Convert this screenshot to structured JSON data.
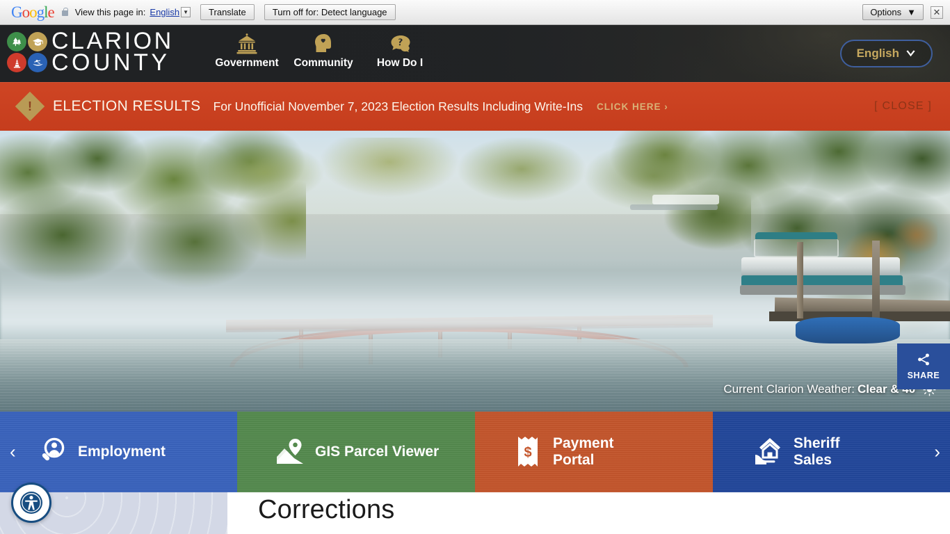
{
  "translate_bar": {
    "brand": "Google",
    "lock_icon": "lock-icon",
    "label": "View this page in:",
    "language_link": "English",
    "dropdown_arrow": "▼",
    "translate_button": "Translate",
    "turnoff_button": "Turn off for: Detect language",
    "options_button": "Options",
    "options_arrow": "▼",
    "close_x": "✕"
  },
  "header": {
    "logo_line1": "CLARION",
    "logo_line2": "COUNTY",
    "logo_icons": [
      "trees-icon",
      "graduation-cap-icon",
      "oil-derrick-icon",
      "canoe-icon"
    ],
    "nav": [
      {
        "label": "Government",
        "icon": "courthouse-icon"
      },
      {
        "label": "Community",
        "icon": "head-heart-icon"
      },
      {
        "label": "How Do I",
        "icon": "question-bubble-icon"
      }
    ],
    "language_selector": {
      "label": "English",
      "chevron": "❯"
    }
  },
  "alert": {
    "icon": "alert-diamond-icon",
    "exclamation": "!",
    "title": "ELECTION RESULTS",
    "message": "For Unofficial November 7, 2023 Election Results Including Write-Ins",
    "cta": "CLICK HERE  ›",
    "close": "[ CLOSE ]"
  },
  "hero": {
    "weather_prefix": "Current Clarion Weather:",
    "weather_value": "Clear & 40°",
    "weather_icon": "sun-icon",
    "share": {
      "label": "SHARE",
      "icon": "share-nodes-icon"
    }
  },
  "quick_links": {
    "prev_arrow": "‹",
    "next_arrow": "›",
    "items": [
      {
        "label": "Employment",
        "icon": "person-search-icon",
        "color": "#3a63bd"
      },
      {
        "label": "GIS Parcel Viewer",
        "icon": "map-pin-icon",
        "color": "#558a4e"
      },
      {
        "label": "Payment Portal",
        "icon": "receipt-dollar-icon",
        "color": "#c4562c"
      },
      {
        "label": "Sheriff Sales",
        "icon": "hand-house-icon",
        "color": "#22479b"
      }
    ]
  },
  "page": {
    "title": "Corrections",
    "accessibility_icon": "accessibility-icon"
  }
}
